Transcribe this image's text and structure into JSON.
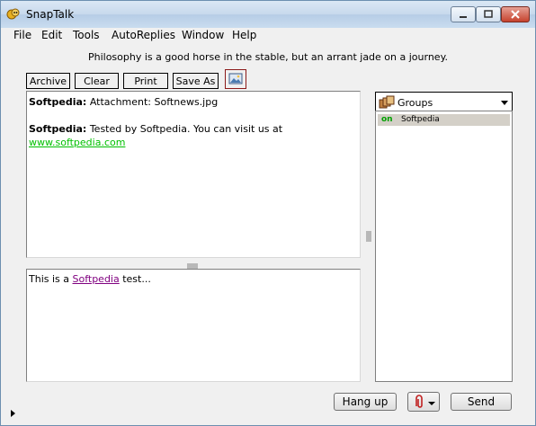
{
  "window": {
    "title": "SnapTalk"
  },
  "menu": [
    "File",
    "Edit",
    "Tools",
    "AutoReplies",
    "Window",
    "Help"
  ],
  "tagline": "Philosophy is a good horse in the stable, but an arrant jade on a journey.",
  "toolbar": {
    "archive": "Archive",
    "clear": "Clear",
    "print": "Print",
    "save_as": "Save As"
  },
  "chat": {
    "messages": [
      {
        "sender": "Softpedia:",
        "text": " Attachment: Softnews.jpg"
      },
      {
        "sender": "Softpedia:",
        "text": " Tested by Softpedia. You can visit us at"
      }
    ],
    "link": "www.softpedia.com",
    "link_color": "#00c000"
  },
  "input": {
    "prefix": "This is a ",
    "link": "Softpedia",
    "suffix": " test...",
    "link_color": "#800080"
  },
  "groups": {
    "selected": "Groups",
    "contacts": [
      {
        "status": "on",
        "name": "Softpedia"
      }
    ]
  },
  "buttons": {
    "hangup": "Hang up",
    "send": "Send"
  },
  "icons": {
    "app": "snaptalk-app-icon",
    "image": "image-icon",
    "groups": "groups-icon",
    "attach": "paperclip-icon"
  }
}
